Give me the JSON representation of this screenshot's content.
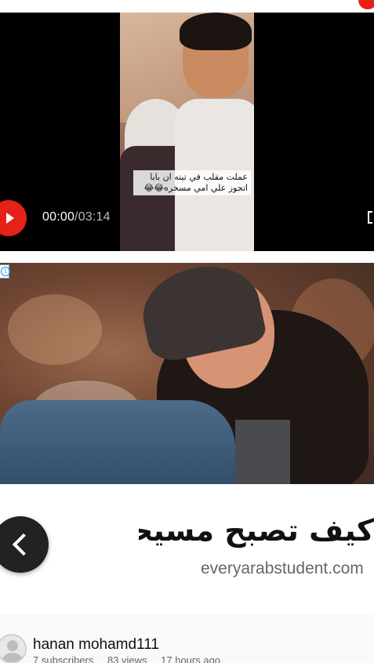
{
  "player": {
    "current_time": "00:00",
    "separator": "/",
    "duration": "03:14",
    "caption": "عملت مقلب في تيته ان بابا اتجوز علي امي مسخره😂😂"
  },
  "ad": {
    "title": "كيف تصبح مسيحيا",
    "domain": "everyarabstudent.com"
  },
  "channel": {
    "name": "hanan mohamd111",
    "subscribers": "7 subscribers",
    "views": "83 views",
    "time_ago": "17 hours ago"
  },
  "colors": {
    "accent_red": "#e62117",
    "video_bg": "#000000"
  },
  "icons": {
    "play": "play-icon",
    "fullscreen": "fullscreen-icon",
    "ad_info": "info-icon",
    "back": "chevron-left-icon",
    "avatar": "default-avatar-icon"
  }
}
